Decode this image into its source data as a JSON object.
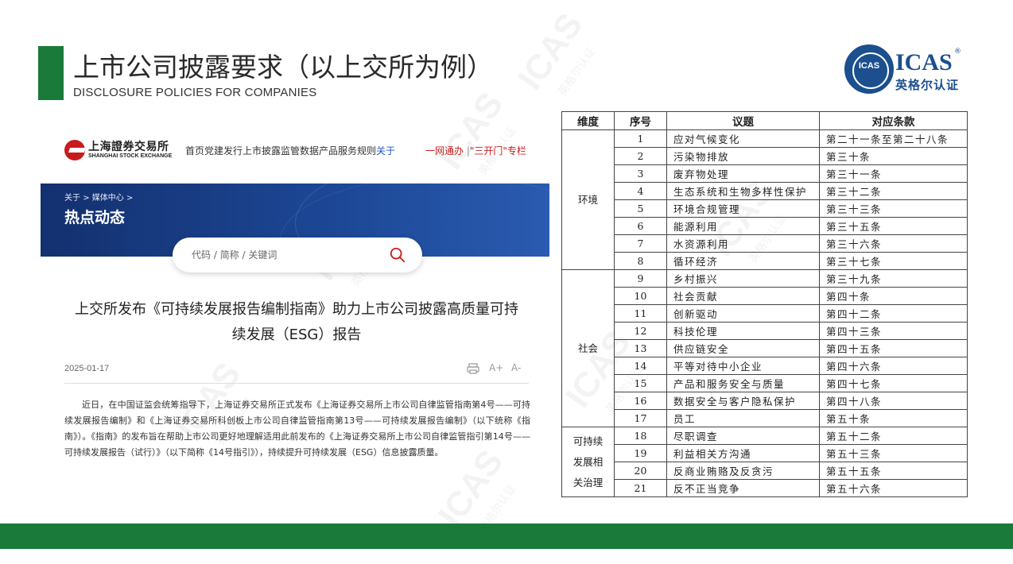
{
  "slide": {
    "title": "上市公司披露要求（以上交所为例）",
    "subtitle": "DISCLOSURE POLICIES FOR COMPANIES"
  },
  "brand": {
    "seal_text": "ICAS",
    "wordmark": "ICAS",
    "registered_mark": "®",
    "chinese_name": "英格尔认证",
    "watermark_text": "ICAS",
    "watermark_cn": "英格尔认证"
  },
  "colors": {
    "accent_green": "#1a7a3a",
    "brand_blue": "#1b4f8e",
    "sse_red": "#c81c1c",
    "banner_blue": "#1c4694"
  },
  "website": {
    "logo_cn": "上海證券交易所",
    "logo_en": "SHANGHAI STOCK EXCHANGE",
    "nav_main": "首页党建发行上市披露监管数据产品服务规则",
    "nav_active": "关于",
    "nav_right_1": "一网通办",
    "nav_sep": "|",
    "nav_right_2": "\"三开门\"专栏",
    "breadcrumb_1": "关于",
    "breadcrumb_sep": ">",
    "breadcrumb_2": "媒体中心",
    "banner_title": "热点动态",
    "search_placeholder": "代码 / 简称 / 关键词",
    "article": {
      "title_line1": "上交所发布《可持续发展报告编制指南》助力上市公司披露高质量可持",
      "title_line2": "续发展（ESG）报告",
      "date": "2025-01-17",
      "tool_font_up": "A+",
      "tool_font_down": "A-",
      "body": "近日，在中国证监会统筹指导下，上海证券交易所正式发布《上海证券交易所上市公司自律监管指南第4号——可持续发展报告编制》和《上海证券交易所科创板上市公司自律监管指南第13号——可持续发展报告编制》（以下统称《指南》）。《指南》的发布旨在帮助上市公司更好地理解适用此前发布的《上海证券交易所上市公司自律监管指引第14号——可持续发展报告（试行）》（以下简称《14号指引》），持续提升可持续发展（ESG）信息披露质量。"
    }
  },
  "table": {
    "headers": [
      "维度",
      "序号",
      "议题",
      "对应条款"
    ],
    "groups": [
      {
        "dimension": "环境",
        "rows": [
          [
            "1",
            "应对气候变化",
            "第二十一条至第二十八条"
          ],
          [
            "2",
            "污染物排放",
            "第三十条"
          ],
          [
            "3",
            "废弃物处理",
            "第三十一条"
          ],
          [
            "4",
            "生态系统和生物多样性保护",
            "第三十二条"
          ],
          [
            "5",
            "环境合规管理",
            "第三十三条"
          ],
          [
            "6",
            "能源利用",
            "第三十五条"
          ],
          [
            "7",
            "水资源利用",
            "第三十六条"
          ],
          [
            "8",
            "循环经济",
            "第三十七条"
          ]
        ]
      },
      {
        "dimension": "社会",
        "rows": [
          [
            "9",
            "乡村振兴",
            "第三十九条"
          ],
          [
            "10",
            "社会贡献",
            "第四十条"
          ],
          [
            "11",
            "创新驱动",
            "第四十二条"
          ],
          [
            "12",
            "科技伦理",
            "第四十三条"
          ],
          [
            "13",
            "供应链安全",
            "第四十五条"
          ],
          [
            "14",
            "平等对待中小企业",
            "第四十六条"
          ],
          [
            "15",
            "产品和服务安全与质量",
            "第四十七条"
          ],
          [
            "16",
            "数据安全与客户隐私保护",
            "第四十八条"
          ],
          [
            "17",
            "员工",
            "第五十条"
          ]
        ]
      },
      {
        "dimension": "可持续发展相关治理",
        "rows": [
          [
            "18",
            "尽职调查",
            "第五十二条"
          ],
          [
            "19",
            "利益相关方沟通",
            "第五十三条"
          ],
          [
            "20",
            "反商业贿赂及反贪污",
            "第五十五条"
          ],
          [
            "21",
            "反不正当竞争",
            "第五十六条"
          ]
        ]
      }
    ]
  }
}
